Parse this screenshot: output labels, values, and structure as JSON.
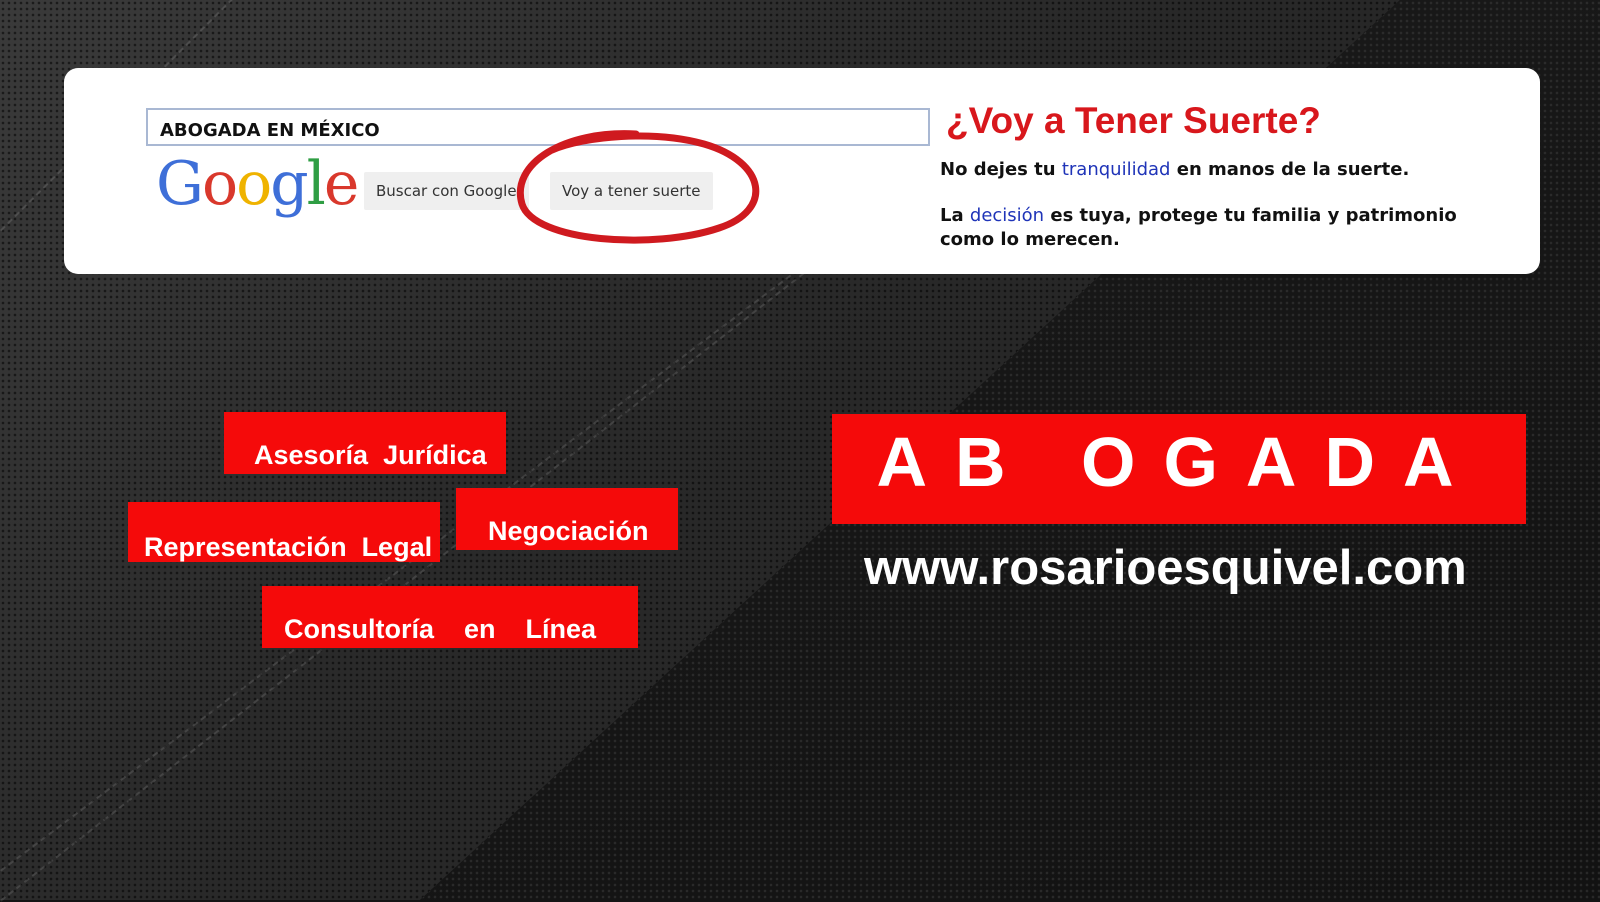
{
  "search": {
    "query": "ABOGADA EN MÉXICO",
    "buttons": {
      "search_label": "Buscar con Google",
      "lucky_label": "Voy a tener suerte"
    }
  },
  "google_logo": [
    "G",
    "o",
    "o",
    "g",
    "l",
    "e"
  ],
  "slogan": {
    "title": "¿Voy a Tener Suerte?",
    "line1_pre": "No dejes tu ",
    "line1_link": "tranquilidad",
    "line1_post": " en manos de la suerte.",
    "line2_pre": "La ",
    "line2_link": "decisión",
    "line2_post": " es tuya, protege tu familia y patrimonio como lo merecen."
  },
  "services": {
    "asesoria": "Asesoría  Jurídica",
    "representacion": "Representación  Legal",
    "negociacion": "Negociación",
    "consultoria": "Consultoría    en    Línea"
  },
  "banner": "AB OGADA",
  "url": "www.rosarioesquivel.com",
  "colors": {
    "accent_red": "#f50a0a",
    "title_red": "#d8171c",
    "link_blue": "#1f34b8"
  }
}
